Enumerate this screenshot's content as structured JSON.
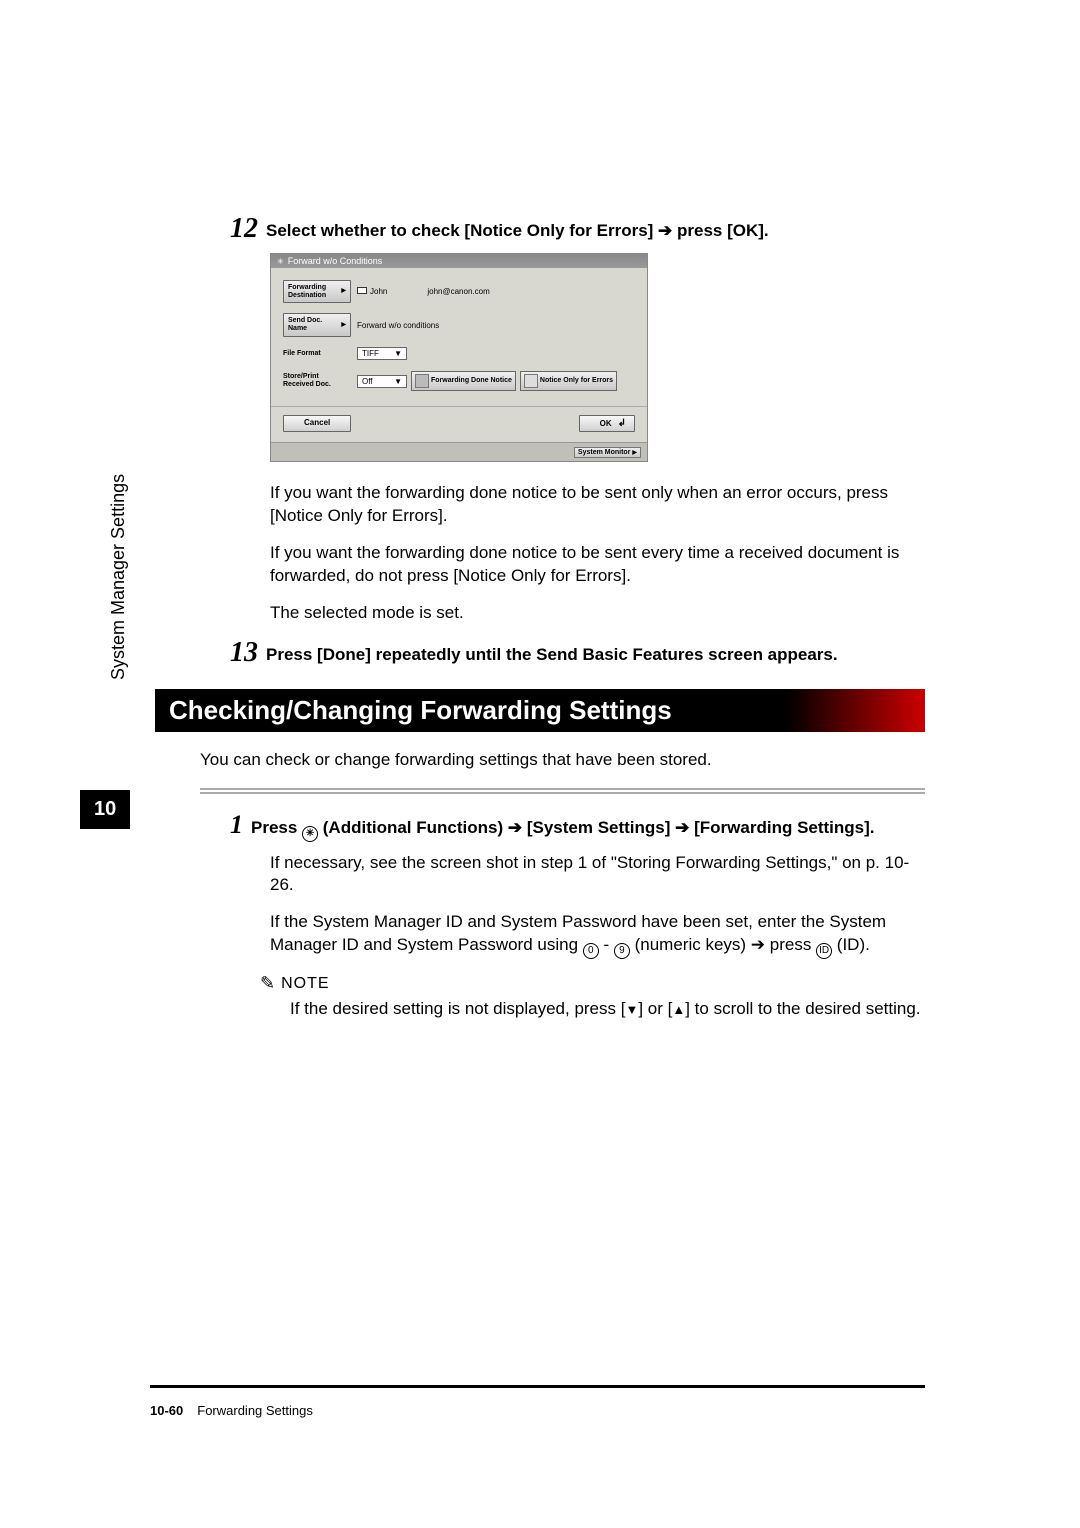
{
  "sidebar": {
    "label": "System Manager Settings"
  },
  "chapter": "10",
  "step12": {
    "num": "12",
    "text_a": "Select whether to check [Notice Only for Errors] ",
    "text_b": " press [OK]."
  },
  "screenshot": {
    "title": "Forward w/o Conditions",
    "rows": {
      "fwd_dest_label": "Forwarding Destination",
      "fwd_dest_value": "John",
      "fwd_dest_email": "john@canon.com",
      "send_doc_label": "Send Doc. Name",
      "send_doc_value": "Forward w/o conditions",
      "file_format_label": "File Format",
      "file_format_value": "TIFF",
      "store_label": "Store/Print Received Doc.",
      "store_value": "Off",
      "fwd_done_label": "Forwarding Done Notice",
      "notice_only_label": "Notice Only for Errors"
    },
    "cancel": "Cancel",
    "ok": "OK",
    "status": "System Monitor"
  },
  "body12": {
    "p1": "If you want the forwarding done notice to be sent only when an error occurs, press [Notice Only for Errors].",
    "p2": "If you want the forwarding done notice to be sent every time a received document is forwarded, do not press [Notice Only for Errors].",
    "p3": "The selected mode is set."
  },
  "step13": {
    "num": "13",
    "text": "Press [Done] repeatedly until the Send Basic Features screen appears."
  },
  "section_title": "Checking/Changing Forwarding Settings",
  "section_intro": "You can check or change forwarding settings that have been stored.",
  "step1": {
    "num": "1",
    "text_a": "Press ",
    "text_b": " (Additional Functions) ",
    "text_c": " [System Settings] ",
    "text_d": " [Forwarding Settings]."
  },
  "body1": {
    "p1": "If necessary, see the screen shot in step 1 of \"Storing Forwarding Settings,\" on p. 10-26.",
    "p2a": "If the System Manager ID and System Password have been set, enter the System Manager ID and System Password using ",
    "p2b": " - ",
    "p2c": " (numeric keys) ",
    "p2d": " press ",
    "p2e": " (ID)."
  },
  "note": {
    "label": "NOTE",
    "text_a": "If the desired setting is not displayed, press [",
    "text_b": "] or [",
    "text_c": "] to scroll to the desired setting."
  },
  "footer": {
    "page": "10-60",
    "title": "Forwarding Settings"
  }
}
